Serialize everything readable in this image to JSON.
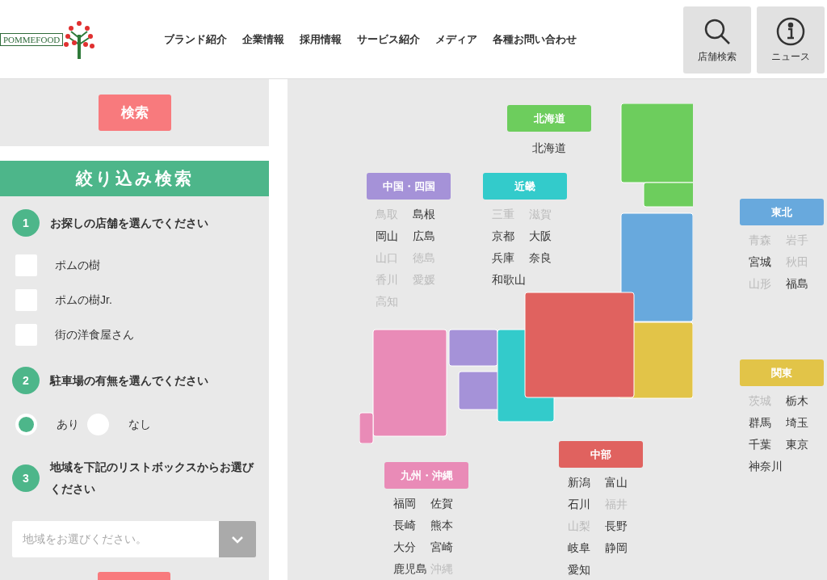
{
  "header": {
    "logo": "POMMEFOOD",
    "nav": [
      "ブランド紹介",
      "企業情報",
      "採用情報",
      "サービス紹介",
      "メディア",
      "各種お問い合わせ"
    ],
    "actions": [
      {
        "kind": "search",
        "label": "店舗検索"
      },
      {
        "kind": "info",
        "label": "ニュース"
      }
    ]
  },
  "sidebar": {
    "search_button": "検索",
    "filter_title": "絞り込み検索",
    "steps": [
      {
        "number": "1",
        "title": "お探しの店舗を選んでください"
      },
      {
        "number": "2",
        "title": "駐車場の有無を選んでください"
      },
      {
        "number": "3",
        "title": "地域を下記のリストボックスからお選びください"
      }
    ],
    "stores": [
      {
        "label": "ポムの樹",
        "checked": false
      },
      {
        "label": "ポムの樹Jr.",
        "checked": false
      },
      {
        "label": "街の洋食屋さん",
        "checked": false
      }
    ],
    "parking": [
      {
        "label": "あり",
        "selected": true
      },
      {
        "label": "なし",
        "selected": false
      }
    ],
    "region_select": {
      "placeholder": "地域をお選びください。"
    }
  },
  "regions": [
    {
      "name": "北海道",
      "color": "#6dcd5d",
      "prefectures": [
        {
          "name": "北海道",
          "disabled": false
        }
      ]
    },
    {
      "name": "中国・四国",
      "color": "#a592d8",
      "prefectures": [
        {
          "name": "鳥取",
          "disabled": true
        },
        {
          "name": "島根",
          "disabled": false
        },
        {
          "name": "岡山",
          "disabled": false
        },
        {
          "name": "広島",
          "disabled": false
        },
        {
          "name": "山口",
          "disabled": true
        },
        {
          "name": "徳島",
          "disabled": true
        },
        {
          "name": "香川",
          "disabled": true
        },
        {
          "name": "愛媛",
          "disabled": true
        },
        {
          "name": "高知",
          "disabled": true
        }
      ]
    },
    {
      "name": "近畿",
      "color": "#33cbcb",
      "prefectures": [
        {
          "name": "三重",
          "disabled": true
        },
        {
          "name": "滋賀",
          "disabled": true
        },
        {
          "name": "京都",
          "disabled": false
        },
        {
          "name": "大阪",
          "disabled": false
        },
        {
          "name": "兵庫",
          "disabled": false
        },
        {
          "name": "奈良",
          "disabled": false
        },
        {
          "name": "和歌山",
          "disabled": false
        }
      ]
    },
    {
      "name": "東北",
      "color": "#68a9dd",
      "prefectures": [
        {
          "name": "青森",
          "disabled": true
        },
        {
          "name": "岩手",
          "disabled": true
        },
        {
          "name": "宮城",
          "disabled": false
        },
        {
          "name": "秋田",
          "disabled": true
        },
        {
          "name": "山形",
          "disabled": true
        },
        {
          "name": "福島",
          "disabled": false
        }
      ]
    },
    {
      "name": "関東",
      "color": "#e2c448",
      "prefectures": [
        {
          "name": "茨城",
          "disabled": true
        },
        {
          "name": "栃木",
          "disabled": false
        },
        {
          "name": "群馬",
          "disabled": false
        },
        {
          "name": "埼玉",
          "disabled": false
        },
        {
          "name": "千葉",
          "disabled": false
        },
        {
          "name": "東京",
          "disabled": false
        },
        {
          "name": "神奈川",
          "disabled": false
        }
      ]
    },
    {
      "name": "九州・沖縄",
      "color": "#e98bb7",
      "prefectures": [
        {
          "name": "福岡",
          "disabled": false
        },
        {
          "name": "佐賀",
          "disabled": false
        },
        {
          "name": "長崎",
          "disabled": false
        },
        {
          "name": "熊本",
          "disabled": false
        },
        {
          "name": "大分",
          "disabled": false
        },
        {
          "name": "宮崎",
          "disabled": false
        },
        {
          "name": "鹿児島",
          "disabled": false
        },
        {
          "name": "沖縄",
          "disabled": true
        }
      ]
    },
    {
      "name": "中部",
      "color": "#e0625f",
      "prefectures": [
        {
          "name": "新潟",
          "disabled": false
        },
        {
          "name": "富山",
          "disabled": false
        },
        {
          "name": "石川",
          "disabled": false
        },
        {
          "name": "福井",
          "disabled": true
        },
        {
          "name": "山梨",
          "disabled": true
        },
        {
          "name": "長野",
          "disabled": false
        },
        {
          "name": "岐阜",
          "disabled": false
        },
        {
          "name": "静岡",
          "disabled": false
        },
        {
          "name": "愛知",
          "disabled": false
        }
      ]
    }
  ]
}
